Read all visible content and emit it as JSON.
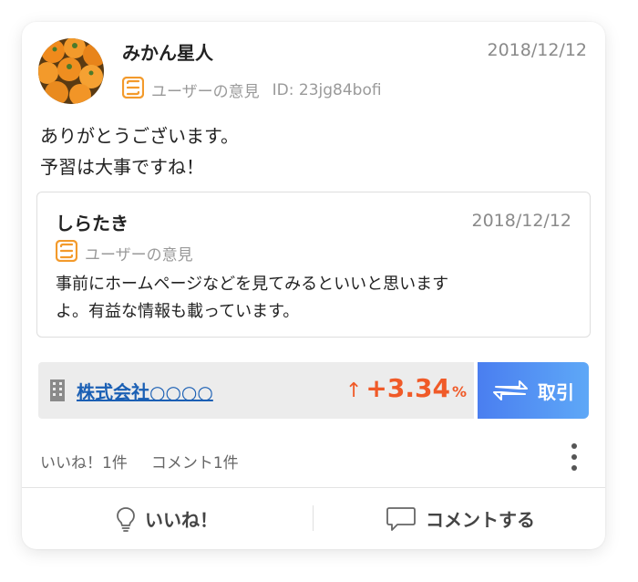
{
  "post": {
    "author": "みかん星人",
    "date": "2018/12/12",
    "badge_label": "ユーザーの意見",
    "user_id": "ID: 23jg84bofi",
    "body_line1": "ありがとうございます。",
    "body_line2": "予習は大事ですね！"
  },
  "quote": {
    "author": "しらたき",
    "date": "2018/12/12",
    "badge_label": "ユーザーの意見",
    "text_line1": "事前にホームページなどを見てみるといいと思います",
    "text_line2": "よ。有益な情報も載っています。"
  },
  "stock": {
    "company": "株式会社○○○○",
    "change_arrow": "↑",
    "change_value": "+3.34",
    "change_unit": "%",
    "trade_label": "取引"
  },
  "stats": {
    "likes": "いいね！1件",
    "comments": "コメント1件"
  },
  "actions": {
    "like_label": "いいね！",
    "comment_label": "コメントする"
  },
  "icons": {
    "badge": "opinion-badge-icon",
    "building": "building-icon",
    "trade": "swap-arrows-icon",
    "more": "more-vertical-icon",
    "like": "lightbulb-icon",
    "comment": "speech-bubble-icon"
  },
  "colors": {
    "accent_orange": "#f39a2b",
    "change_red": "#f05a28",
    "link_blue": "#1a5fb4",
    "button_gradient_start": "#4a7ef0",
    "button_gradient_end": "#5ea8f7"
  }
}
